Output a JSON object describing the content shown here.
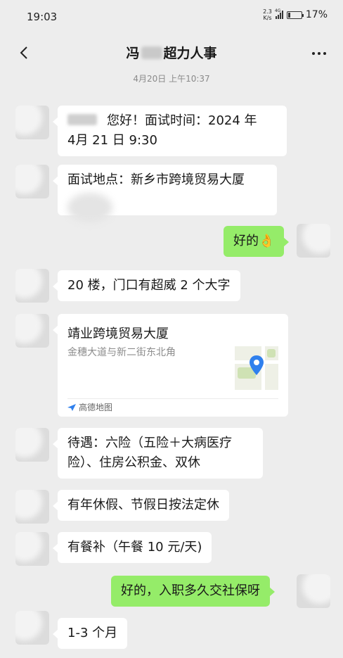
{
  "status_bar": {
    "time": "19:03",
    "net_speed_value": "2.3",
    "net_speed_unit": "K/s",
    "network_type": "4G",
    "battery_percent": "17%",
    "battery_level": 0.17
  },
  "header": {
    "title_prefix": "冯",
    "title_suffix": "超力人事"
  },
  "timestamp": "4月20日 上午10:37",
  "messages": [
    {
      "side": "left",
      "text": "您好！面试时间：2024 年\n4月 21 日 9:30"
    },
    {
      "side": "left",
      "text": "面试地点：新乡市跨境贸易大厦"
    },
    {
      "side": "right",
      "text": "好的👌"
    },
    {
      "side": "left",
      "text": "20 楼，门口有超威 2 个大字"
    },
    {
      "side": "left",
      "type": "location",
      "title": "靖业跨境贸易大厦",
      "address": "金穗大道与新二街东北角",
      "source": "高德地图"
    },
    {
      "side": "left",
      "text": "待遇：六险（五险＋大病医疗\n险）、住房公积金、双休"
    },
    {
      "side": "left",
      "text": "有年休假、节假日按法定休"
    },
    {
      "side": "left",
      "text": "有餐补（午餐 10 元/天)"
    },
    {
      "side": "right",
      "text": "好的，入职多久交社保呀"
    },
    {
      "side": "left",
      "text": "1-3 个月"
    }
  ],
  "colors": {
    "background": "#ededed",
    "bubble_self": "#95ec69",
    "bubble_other": "#ffffff",
    "location_pin": "#2f80ed"
  }
}
